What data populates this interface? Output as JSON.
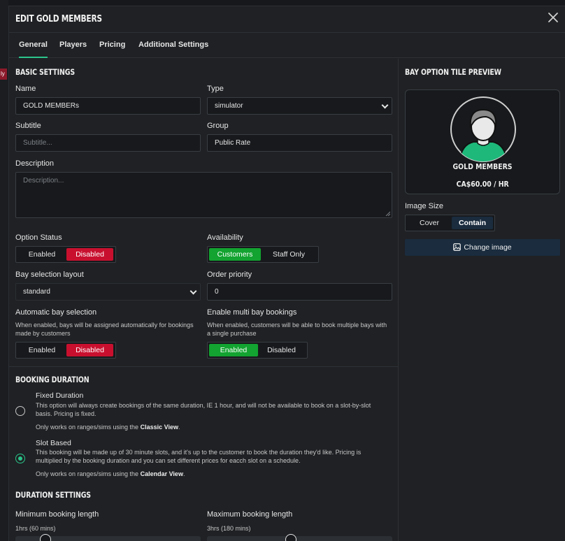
{
  "background": {
    "badge_text": "ly"
  },
  "modal": {
    "title": "EDIT GOLD MEMBERS"
  },
  "tabs": [
    {
      "label": "General"
    },
    {
      "label": "Players"
    },
    {
      "label": "Pricing"
    },
    {
      "label": "Additional Settings"
    }
  ],
  "basic": {
    "title": "BASIC SETTINGS",
    "name": {
      "label": "Name",
      "value": "GOLD MEMBERs"
    },
    "type": {
      "label": "Type",
      "value": "simulator"
    },
    "subtitle": {
      "label": "Subtitle",
      "placeholder": "Subtitle..."
    },
    "group": {
      "label": "Group",
      "value": "Public Rate"
    },
    "description": {
      "label": "Description",
      "placeholder": "Description..."
    },
    "option_status": {
      "label": "Option Status",
      "options": [
        "Enabled",
        "Disabled"
      ],
      "selected": "Disabled"
    },
    "availability": {
      "label": "Availability",
      "options": [
        "Customers",
        "Staff Only"
      ],
      "selected": "Customers"
    },
    "bay_layout": {
      "label": "Bay selection layout",
      "value": "standard"
    },
    "order_priority": {
      "label": "Order priority",
      "value": "0"
    },
    "auto_bay": {
      "label": "Automatic bay selection",
      "hint": "When enabled, bays will be assigned automatically for bookings made by customers",
      "options": [
        "Enabled",
        "Disabled"
      ],
      "selected": "Disabled"
    },
    "multi_bay": {
      "label": "Enable multi bay bookings",
      "hint": "When enabled, customers will be able to book multiple bays with a single purchase",
      "options": [
        "Enabled",
        "Disabled"
      ],
      "selected": "Enabled"
    }
  },
  "booking": {
    "title": "BOOKING DURATION",
    "fixed": {
      "title": "Fixed Duration",
      "desc": "This option will always create bookings of the same duration, IE 1 hour, and will not be available to book on a slot-by-slot basis. Pricing is fixed.",
      "note_prefix": "Only works on ranges/sims using the ",
      "note_bold": "Classic View",
      "note_suffix": ".",
      "checked": false
    },
    "slot": {
      "title": "Slot Based",
      "desc": "This booking will be made up of 30 minute slots, and it's up to the customer to book the duration they'd like. Pricing is multiplied by the booking duration and you can set different prices for eacch slot on a schedule.",
      "note_prefix": "Only works on ranges/sims using the ",
      "note_bold": "Calendar View",
      "note_suffix": ".",
      "checked": true
    }
  },
  "duration": {
    "title": "DURATION SETTINGS",
    "min": {
      "label": "Minimum booking length",
      "value_text": "1hrs (60 mins)",
      "fraction": 0.14
    },
    "max": {
      "label": "Maximum booking length",
      "value_text": "3hrs (180 mins)",
      "fraction": 0.45
    }
  },
  "preview": {
    "title": "BAY OPTION TILE PREVIEW",
    "name": "GOLD MEMBERS",
    "price": "CA$60.00 / HR",
    "image_size": {
      "label": "Image Size",
      "options": [
        "Cover",
        "Contain"
      ],
      "selected": "Contain"
    },
    "change_image": "Change image"
  },
  "colors": {
    "accent": "#2bc48a",
    "danger": "#c8102e",
    "success": "#12a330",
    "navy": "#1a2c3e",
    "avatar_shirt": "#1db87a"
  }
}
